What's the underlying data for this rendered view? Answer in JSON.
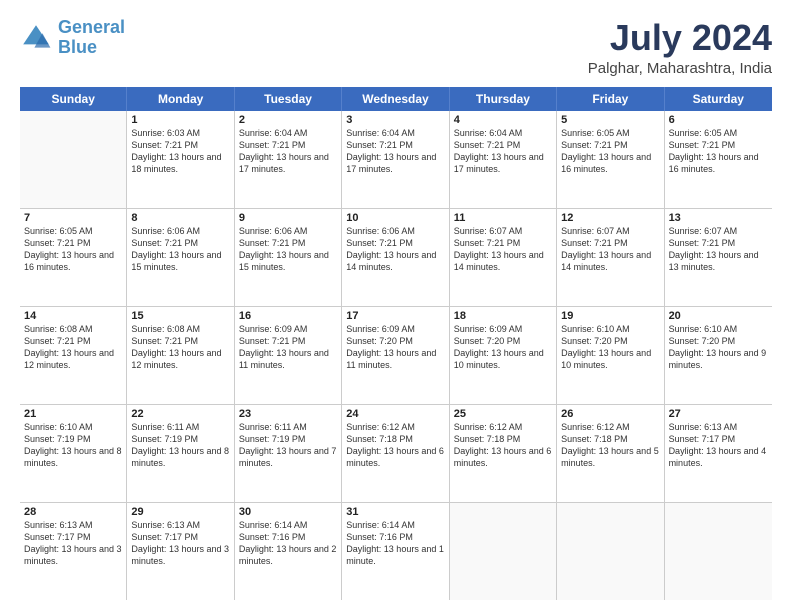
{
  "logo": {
    "line1": "General",
    "line2": "Blue"
  },
  "title": "July 2024",
  "subtitle": "Palghar, Maharashtra, India",
  "headers": [
    "Sunday",
    "Monday",
    "Tuesday",
    "Wednesday",
    "Thursday",
    "Friday",
    "Saturday"
  ],
  "weeks": [
    [
      {
        "day": "",
        "sunrise": "",
        "sunset": "",
        "daylight": ""
      },
      {
        "day": "1",
        "sunrise": "Sunrise: 6:03 AM",
        "sunset": "Sunset: 7:21 PM",
        "daylight": "Daylight: 13 hours and 18 minutes."
      },
      {
        "day": "2",
        "sunrise": "Sunrise: 6:04 AM",
        "sunset": "Sunset: 7:21 PM",
        "daylight": "Daylight: 13 hours and 17 minutes."
      },
      {
        "day": "3",
        "sunrise": "Sunrise: 6:04 AM",
        "sunset": "Sunset: 7:21 PM",
        "daylight": "Daylight: 13 hours and 17 minutes."
      },
      {
        "day": "4",
        "sunrise": "Sunrise: 6:04 AM",
        "sunset": "Sunset: 7:21 PM",
        "daylight": "Daylight: 13 hours and 17 minutes."
      },
      {
        "day": "5",
        "sunrise": "Sunrise: 6:05 AM",
        "sunset": "Sunset: 7:21 PM",
        "daylight": "Daylight: 13 hours and 16 minutes."
      },
      {
        "day": "6",
        "sunrise": "Sunrise: 6:05 AM",
        "sunset": "Sunset: 7:21 PM",
        "daylight": "Daylight: 13 hours and 16 minutes."
      }
    ],
    [
      {
        "day": "7",
        "sunrise": "Sunrise: 6:05 AM",
        "sunset": "Sunset: 7:21 PM",
        "daylight": "Daylight: 13 hours and 16 minutes."
      },
      {
        "day": "8",
        "sunrise": "Sunrise: 6:06 AM",
        "sunset": "Sunset: 7:21 PM",
        "daylight": "Daylight: 13 hours and 15 minutes."
      },
      {
        "day": "9",
        "sunrise": "Sunrise: 6:06 AM",
        "sunset": "Sunset: 7:21 PM",
        "daylight": "Daylight: 13 hours and 15 minutes."
      },
      {
        "day": "10",
        "sunrise": "Sunrise: 6:06 AM",
        "sunset": "Sunset: 7:21 PM",
        "daylight": "Daylight: 13 hours and 14 minutes."
      },
      {
        "day": "11",
        "sunrise": "Sunrise: 6:07 AM",
        "sunset": "Sunset: 7:21 PM",
        "daylight": "Daylight: 13 hours and 14 minutes."
      },
      {
        "day": "12",
        "sunrise": "Sunrise: 6:07 AM",
        "sunset": "Sunset: 7:21 PM",
        "daylight": "Daylight: 13 hours and 14 minutes."
      },
      {
        "day": "13",
        "sunrise": "Sunrise: 6:07 AM",
        "sunset": "Sunset: 7:21 PM",
        "daylight": "Daylight: 13 hours and 13 minutes."
      }
    ],
    [
      {
        "day": "14",
        "sunrise": "Sunrise: 6:08 AM",
        "sunset": "Sunset: 7:21 PM",
        "daylight": "Daylight: 13 hours and 12 minutes."
      },
      {
        "day": "15",
        "sunrise": "Sunrise: 6:08 AM",
        "sunset": "Sunset: 7:21 PM",
        "daylight": "Daylight: 13 hours and 12 minutes."
      },
      {
        "day": "16",
        "sunrise": "Sunrise: 6:09 AM",
        "sunset": "Sunset: 7:21 PM",
        "daylight": "Daylight: 13 hours and 11 minutes."
      },
      {
        "day": "17",
        "sunrise": "Sunrise: 6:09 AM",
        "sunset": "Sunset: 7:20 PM",
        "daylight": "Daylight: 13 hours and 11 minutes."
      },
      {
        "day": "18",
        "sunrise": "Sunrise: 6:09 AM",
        "sunset": "Sunset: 7:20 PM",
        "daylight": "Daylight: 13 hours and 10 minutes."
      },
      {
        "day": "19",
        "sunrise": "Sunrise: 6:10 AM",
        "sunset": "Sunset: 7:20 PM",
        "daylight": "Daylight: 13 hours and 10 minutes."
      },
      {
        "day": "20",
        "sunrise": "Sunrise: 6:10 AM",
        "sunset": "Sunset: 7:20 PM",
        "daylight": "Daylight: 13 hours and 9 minutes."
      }
    ],
    [
      {
        "day": "21",
        "sunrise": "Sunrise: 6:10 AM",
        "sunset": "Sunset: 7:19 PM",
        "daylight": "Daylight: 13 hours and 8 minutes."
      },
      {
        "day": "22",
        "sunrise": "Sunrise: 6:11 AM",
        "sunset": "Sunset: 7:19 PM",
        "daylight": "Daylight: 13 hours and 8 minutes."
      },
      {
        "day": "23",
        "sunrise": "Sunrise: 6:11 AM",
        "sunset": "Sunset: 7:19 PM",
        "daylight": "Daylight: 13 hours and 7 minutes."
      },
      {
        "day": "24",
        "sunrise": "Sunrise: 6:12 AM",
        "sunset": "Sunset: 7:18 PM",
        "daylight": "Daylight: 13 hours and 6 minutes."
      },
      {
        "day": "25",
        "sunrise": "Sunrise: 6:12 AM",
        "sunset": "Sunset: 7:18 PM",
        "daylight": "Daylight: 13 hours and 6 minutes."
      },
      {
        "day": "26",
        "sunrise": "Sunrise: 6:12 AM",
        "sunset": "Sunset: 7:18 PM",
        "daylight": "Daylight: 13 hours and 5 minutes."
      },
      {
        "day": "27",
        "sunrise": "Sunrise: 6:13 AM",
        "sunset": "Sunset: 7:17 PM",
        "daylight": "Daylight: 13 hours and 4 minutes."
      }
    ],
    [
      {
        "day": "28",
        "sunrise": "Sunrise: 6:13 AM",
        "sunset": "Sunset: 7:17 PM",
        "daylight": "Daylight: 13 hours and 3 minutes."
      },
      {
        "day": "29",
        "sunrise": "Sunrise: 6:13 AM",
        "sunset": "Sunset: 7:17 PM",
        "daylight": "Daylight: 13 hours and 3 minutes."
      },
      {
        "day": "30",
        "sunrise": "Sunrise: 6:14 AM",
        "sunset": "Sunset: 7:16 PM",
        "daylight": "Daylight: 13 hours and 2 minutes."
      },
      {
        "day": "31",
        "sunrise": "Sunrise: 6:14 AM",
        "sunset": "Sunset: 7:16 PM",
        "daylight": "Daylight: 13 hours and 1 minute."
      },
      {
        "day": "",
        "sunrise": "",
        "sunset": "",
        "daylight": ""
      },
      {
        "day": "",
        "sunrise": "",
        "sunset": "",
        "daylight": ""
      },
      {
        "day": "",
        "sunrise": "",
        "sunset": "",
        "daylight": ""
      }
    ]
  ]
}
